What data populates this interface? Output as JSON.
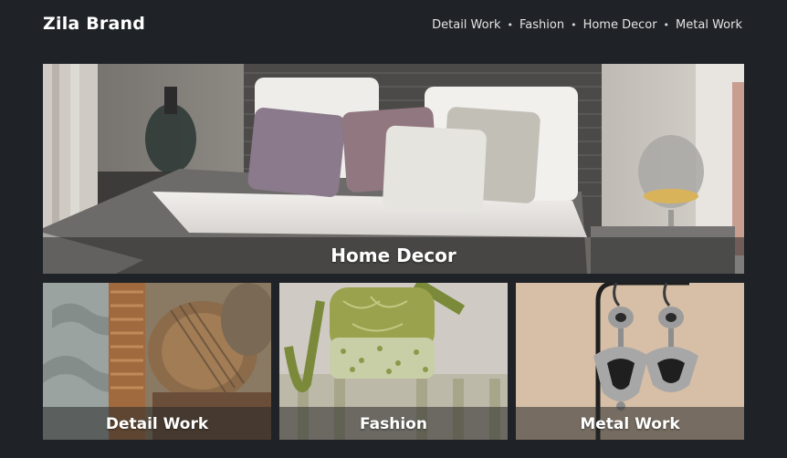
{
  "header": {
    "brand": "Zila Brand",
    "nav": [
      {
        "label": "Detail Work"
      },
      {
        "label": "Fashion"
      },
      {
        "label": "Home Decor"
      },
      {
        "label": "Metal Work"
      }
    ],
    "separator": "•"
  },
  "tiles": {
    "featured": {
      "caption": "Home Decor"
    },
    "detail": {
      "caption": "Detail Work"
    },
    "fashion": {
      "caption": "Fashion"
    },
    "metal": {
      "caption": "Metal Work"
    }
  },
  "colors": {
    "background": "#1f2227",
    "text": "#ffffff"
  }
}
